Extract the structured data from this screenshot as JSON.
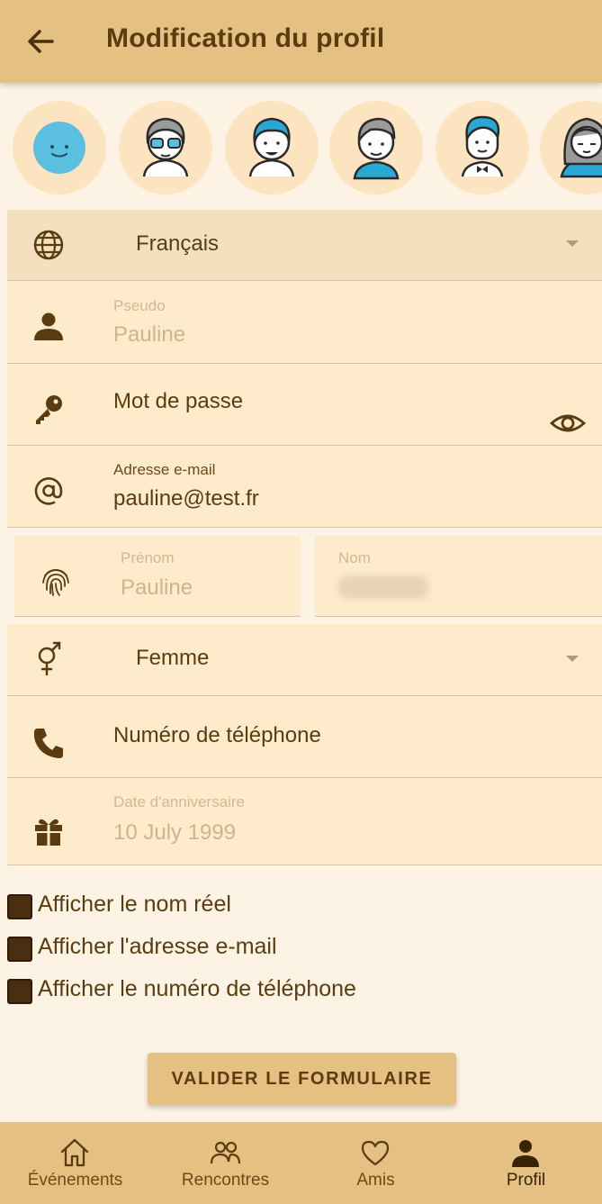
{
  "header": {
    "title": "Modification du profil",
    "back_icon": "arrow-left-icon"
  },
  "avatars": [
    {
      "name": "avatar-smiley",
      "selected": true
    },
    {
      "name": "avatar-glasses"
    },
    {
      "name": "avatar-blue-hair"
    },
    {
      "name": "avatar-grey-hair"
    },
    {
      "name": "avatar-blue-bowtie"
    },
    {
      "name": "avatar-woman-grey"
    }
  ],
  "form": {
    "language": {
      "value": "Français",
      "icon": "globe-icon"
    },
    "pseudo": {
      "label": "Pseudo",
      "value": "Pauline",
      "icon": "person-icon"
    },
    "password": {
      "placeholder": "Mot de passe",
      "icon": "key-icon",
      "toggle_icon": "eye-icon"
    },
    "email": {
      "label": "Adresse e-mail",
      "value": "pauline@test.fr",
      "icon": "at-sign-icon"
    },
    "firstname": {
      "label": "Prénom",
      "value": "Pauline",
      "icon": "fingerprint-icon"
    },
    "lastname": {
      "label": "Nom"
    },
    "gender": {
      "value": "Femme",
      "icon": "gender-icon"
    },
    "phone": {
      "placeholder": "Numéro de téléphone",
      "icon": "phone-icon"
    },
    "birthday": {
      "label": "Date d'anniversaire",
      "value": "10 July 1999",
      "icon": "gift-icon"
    }
  },
  "options": [
    {
      "label": "Afficher le nom réel",
      "checked": false
    },
    {
      "label": "Afficher l'adresse e-mail",
      "checked": false
    },
    {
      "label": "Afficher le numéro de téléphone",
      "checked": false
    }
  ],
  "submit_label": "VALIDER LE FORMULAIRE",
  "nav": [
    {
      "label": "Événements",
      "icon": "home-icon"
    },
    {
      "label": "Rencontres",
      "icon": "people-icon"
    },
    {
      "label": "Amis",
      "icon": "heart-icon"
    },
    {
      "label": "Profil",
      "icon": "person-icon",
      "active": true
    }
  ],
  "colors": {
    "primary": "#e5c083",
    "background": "#fdf3e5",
    "field": "#feebcc",
    "text": "#5a3c10"
  }
}
